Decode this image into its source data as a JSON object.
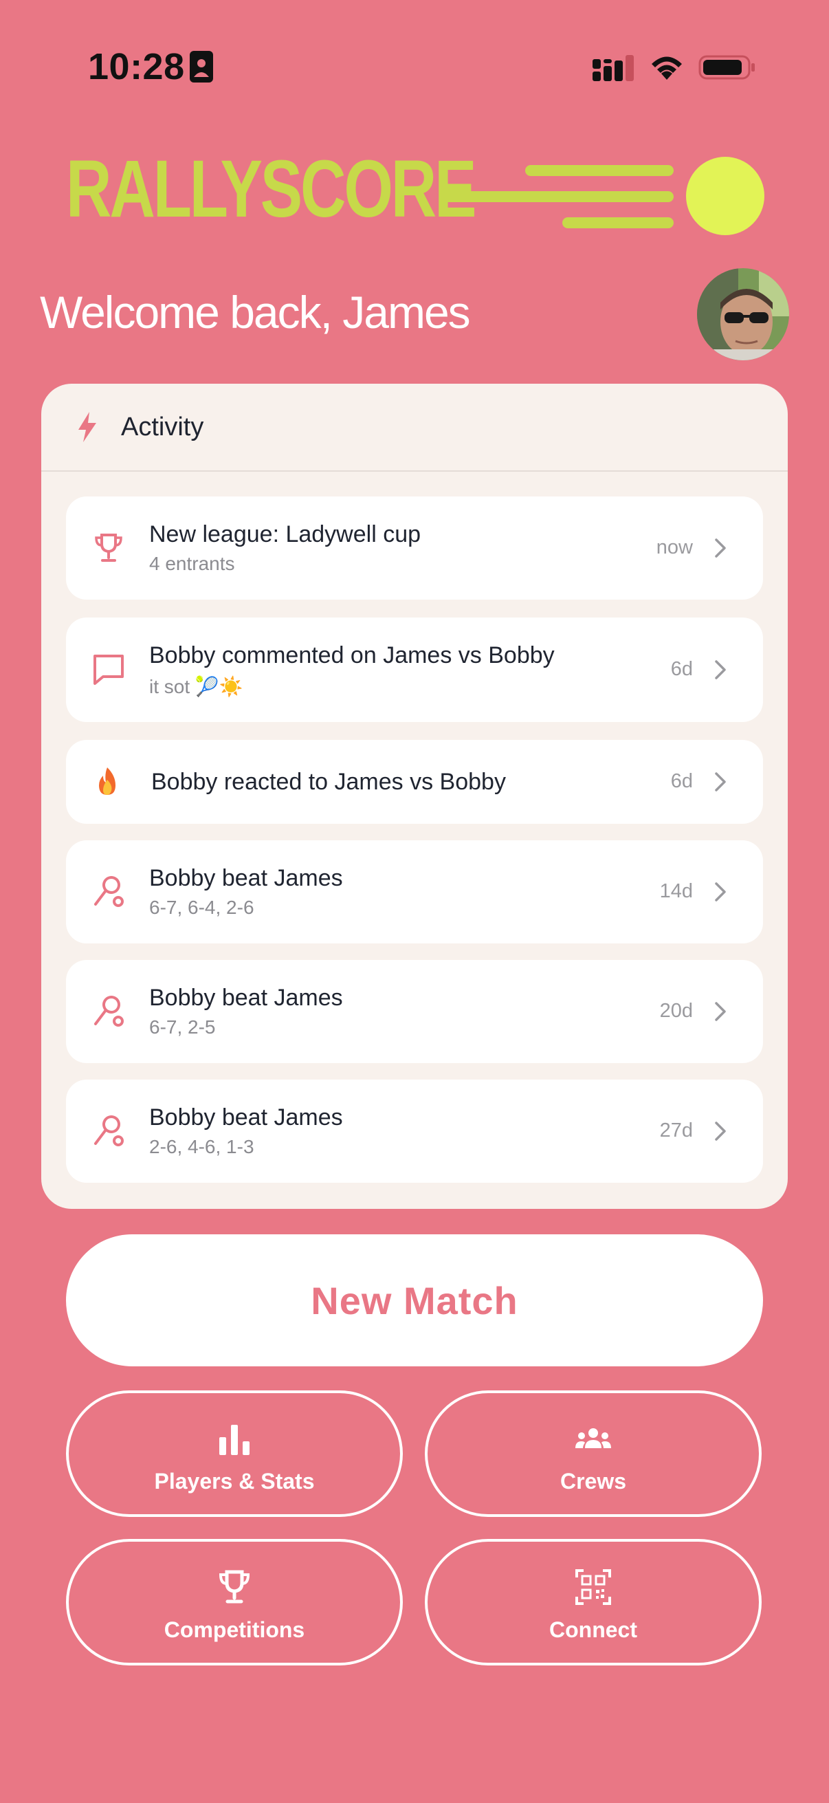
{
  "status_bar": {
    "time": "10:28"
  },
  "app": {
    "name": "RALLYSCORE",
    "brand_color": "#c7d94a",
    "ball_color": "#e2f356",
    "background": "#e97785"
  },
  "welcome": {
    "text": "Welcome back, James"
  },
  "activity": {
    "title": "Activity",
    "items": [
      {
        "icon": "trophy-icon",
        "title": "New league: Ladywell cup",
        "subtitle": "4 entrants",
        "time": "now"
      },
      {
        "icon": "comment-icon",
        "title": "Bobby commented on James vs Bobby",
        "subtitle": "it sot 🎾☀️",
        "time": "6d"
      },
      {
        "icon": "fire-emoji",
        "title": "Bobby reacted to James vs Bobby",
        "subtitle": "",
        "time": "6d"
      },
      {
        "icon": "racket-icon",
        "title": "Bobby beat James",
        "subtitle": "6-7, 6-4, 2-6",
        "time": "14d"
      },
      {
        "icon": "racket-icon",
        "title": "Bobby beat James",
        "subtitle": "6-7, 2-5",
        "time": "20d"
      },
      {
        "icon": "racket-icon",
        "title": "Bobby beat James",
        "subtitle": "2-6, 4-6, 1-3",
        "time": "27d"
      }
    ]
  },
  "actions": {
    "new_match": "New Match",
    "players_stats": "Players & Stats",
    "crews": "Crews",
    "competitions": "Competitions",
    "connect": "Connect"
  }
}
